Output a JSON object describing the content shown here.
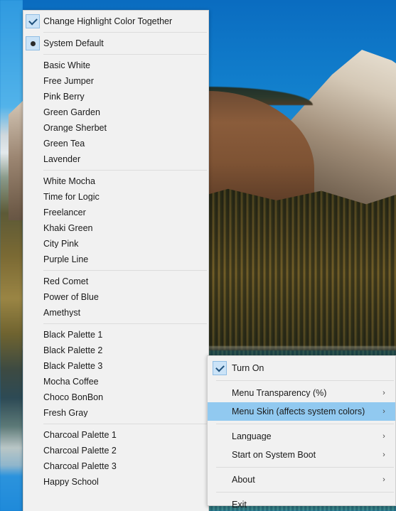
{
  "wallpaper": {
    "description": "mountain-lake-landscape"
  },
  "colors": {
    "menu_background": "#f1f1f1",
    "menu_border": "#cfcfcf",
    "highlight": "#91c9f0",
    "icon_box_fill": "#cbe3f7",
    "icon_box_border": "#8fbde4",
    "separator": "#dcdcdc",
    "text": "#1a1a1a"
  },
  "left_menu": {
    "name": "menu-skin-submenu",
    "groups": [
      {
        "items": [
          {
            "label": "Change Highlight Color Together",
            "icon": "check-icon",
            "checked": true
          }
        ]
      },
      {
        "items": [
          {
            "label": "System Default",
            "icon": "radio-dot-icon",
            "selected": true
          }
        ]
      },
      {
        "items": [
          {
            "label": "Basic White"
          },
          {
            "label": "Free Jumper"
          },
          {
            "label": "Pink Berry"
          },
          {
            "label": "Green Garden"
          },
          {
            "label": "Orange Sherbet"
          },
          {
            "label": "Green Tea"
          },
          {
            "label": "Lavender"
          }
        ]
      },
      {
        "items": [
          {
            "label": "White Mocha"
          },
          {
            "label": "Time for Logic"
          },
          {
            "label": "Freelancer"
          },
          {
            "label": "Khaki Green"
          },
          {
            "label": "City Pink"
          },
          {
            "label": "Purple Line"
          }
        ]
      },
      {
        "items": [
          {
            "label": "Red Comet"
          },
          {
            "label": "Power of Blue"
          },
          {
            "label": "Amethyst"
          }
        ]
      },
      {
        "items": [
          {
            "label": "Black Palette 1"
          },
          {
            "label": "Black Palette 2"
          },
          {
            "label": "Black Palette 3"
          },
          {
            "label": "Mocha Coffee"
          },
          {
            "label": "Choco BonBon"
          },
          {
            "label": "Fresh Gray"
          }
        ]
      },
      {
        "items": [
          {
            "label": "Charcoal Palette 1"
          },
          {
            "label": "Charcoal Palette 2"
          },
          {
            "label": "Charcoal Palette 3"
          },
          {
            "label": "Happy School"
          }
        ]
      }
    ]
  },
  "right_menu": {
    "name": "tray-context-menu",
    "groups": [
      {
        "items": [
          {
            "label": "Turn On",
            "icon": "check-icon",
            "checked": true,
            "submenu": false
          }
        ]
      },
      {
        "items": [
          {
            "label": "Menu Transparency (%)",
            "submenu": true,
            "chevron": "›"
          },
          {
            "label": "Menu Skin (affects system colors)",
            "submenu": true,
            "chevron": "›",
            "highlighted": true
          }
        ]
      },
      {
        "items": [
          {
            "label": "Language",
            "submenu": true,
            "chevron": "›"
          },
          {
            "label": "Start on System Boot",
            "submenu": true,
            "chevron": "›"
          }
        ]
      },
      {
        "items": [
          {
            "label": "About",
            "submenu": true,
            "chevron": "›"
          }
        ]
      },
      {
        "items": [
          {
            "label": "Exit",
            "submenu": false
          }
        ]
      }
    ]
  }
}
